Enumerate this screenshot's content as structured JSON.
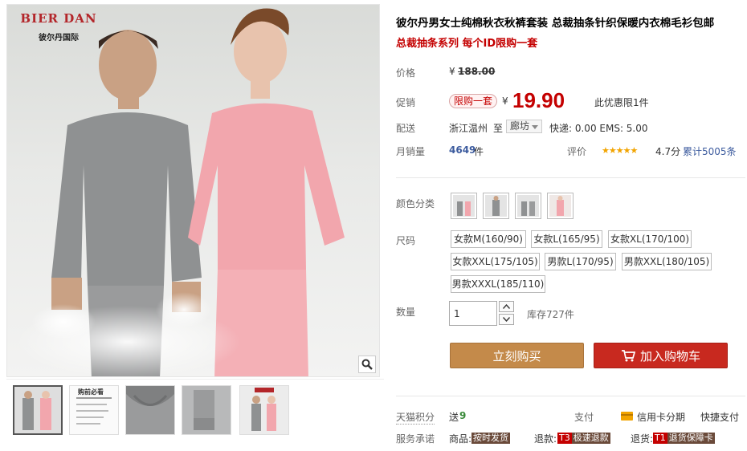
{
  "gallery": {
    "brand_logo_text": "BIER DAN",
    "brand_cn": "彼尔丹国际",
    "zoom_icon": "magnifier-icon",
    "thumbnails": [
      {
        "name": "thumb-couple-front"
      },
      {
        "name": "thumb-size-guide"
      },
      {
        "name": "thumb-collar-detail"
      },
      {
        "name": "thumb-cuff-detail"
      },
      {
        "name": "thumb-couple-brand"
      }
    ],
    "size_guide_title": "购前必看"
  },
  "product": {
    "title": "彼尔丹男女士纯棉秋衣秋裤套装 总裁抽条针织保暖内衣棉毛衫包邮",
    "subtitle": "总裁抽条系列 每个ID限购一套"
  },
  "price": {
    "label": "价格",
    "currency": "¥",
    "original": "188.00"
  },
  "promo": {
    "label": "促销",
    "tag": "限购一套",
    "currency": "¥",
    "price": "19.90",
    "note": "此优惠限1件"
  },
  "shipping": {
    "label": "配送",
    "from": "浙江温州",
    "to_word": "至",
    "region": "廊坊",
    "fee": "快递: 0.00 EMS: 5.00"
  },
  "sales": {
    "label": "月销量",
    "count": "4649",
    "unit": "件",
    "rating_label": "评价",
    "stars": "★★★★★",
    "score": "4.7分",
    "total": "累计5005条"
  },
  "color": {
    "label": "颜色分类",
    "options": [
      "pink-grey",
      "grey",
      "grey-pink",
      "pink"
    ]
  },
  "size": {
    "label": "尺码",
    "options": [
      "女款M(160/90)",
      "女款L(165/95)",
      "女款XL(170/100)",
      "女款XXL(175/105)",
      "男款L(170/95)",
      "男款XXL(180/105)",
      "男款XXXL(185/110)"
    ]
  },
  "quantity": {
    "label": "数量",
    "value": "1",
    "stock": "库存727件"
  },
  "actions": {
    "buy_now": "立刻购买",
    "add_to_cart": "加入购物车",
    "cart_icon": "cart-icon"
  },
  "footer": {
    "points_label": "天猫积分",
    "points_prefix": "送",
    "points_value": "9",
    "pay_label": "支付",
    "credit_label": "信用卡分期",
    "quick_pay": "快捷支付",
    "service_label": "服务承诺",
    "goods_label": "商品:",
    "goods_tag": "按时发货",
    "refund_label": "退款:",
    "refund_t": "T3",
    "refund_tag": "极速退款",
    "return_label": "退货:",
    "return_t": "T1",
    "return_tag": "退货保障卡"
  },
  "colors": {
    "accent_red": "#c40000",
    "buy_button": "#c48a4a",
    "cart_button": "#c8291f",
    "star": "#f2a400"
  }
}
